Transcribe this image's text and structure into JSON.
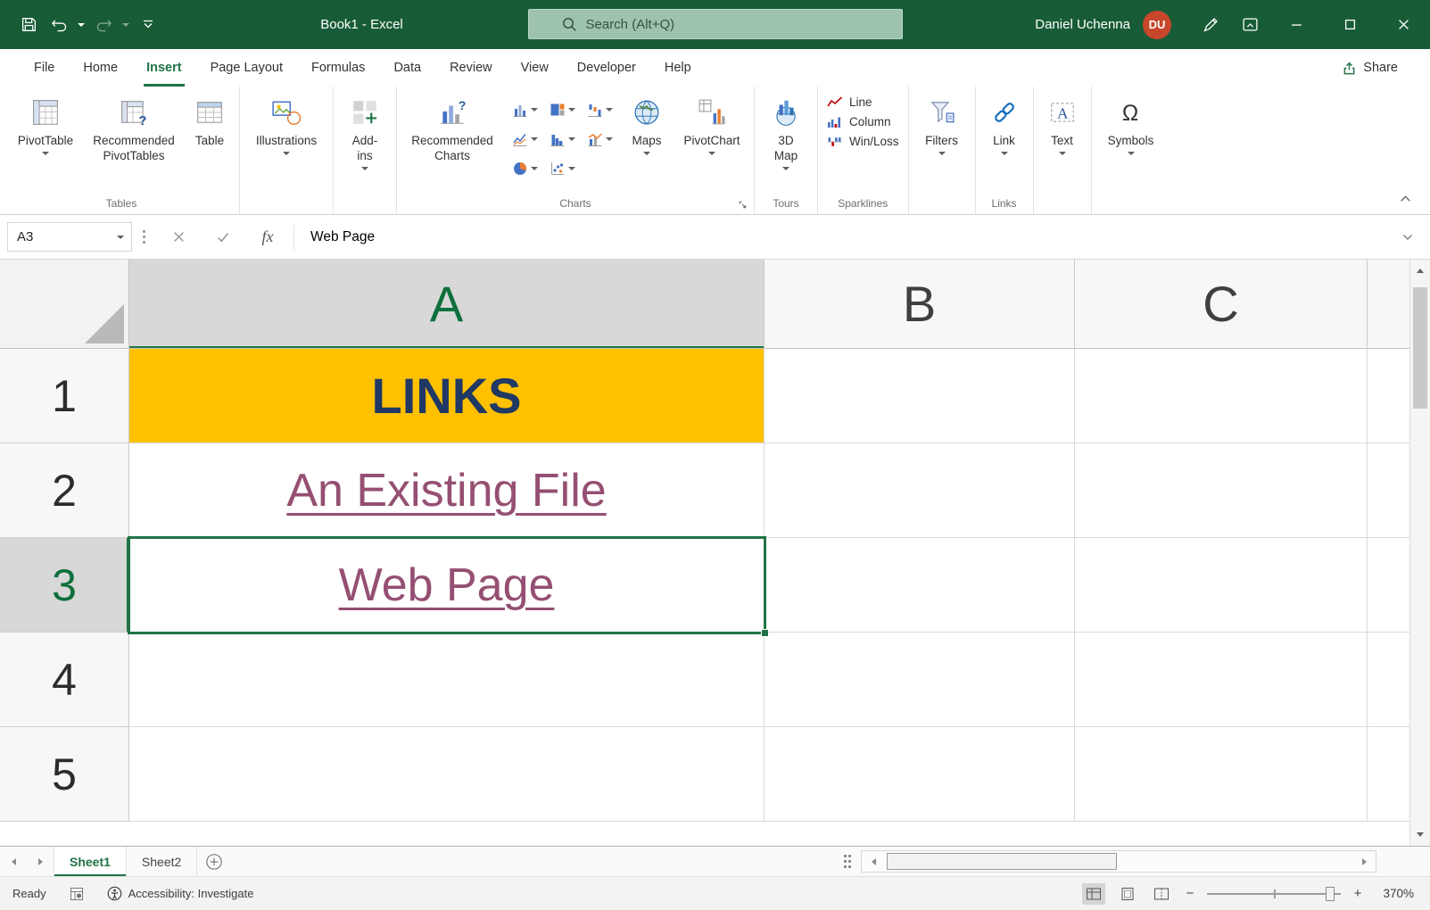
{
  "colors": {
    "title_bar_green": "#185C37",
    "accent_green": "#217346",
    "cell_fill_gold": "#FFC000",
    "links_header_navy": "#1F3864",
    "followed_hyperlink_purple": "#954F72",
    "avatar_orange": "#C8472B"
  },
  "titlebar": {
    "title": "Book1 - Excel",
    "search_placeholder": "Search (Alt+Q)",
    "user_name": "Daniel Uchenna",
    "user_initials": "DU"
  },
  "tabs": {
    "file": "File",
    "home": "Home",
    "insert": "Insert",
    "page_layout": "Page Layout",
    "formulas": "Formulas",
    "data": "Data",
    "review": "Review",
    "view": "View",
    "developer": "Developer",
    "help": "Help",
    "share": "Share"
  },
  "ribbon": {
    "pivottable": "PivotTable",
    "recommended_pivottables": "Recommended PivotTables",
    "table": "Table",
    "tables_group": "Tables",
    "illustrations": "Illustrations",
    "addins": "Add-ins",
    "recommended_charts": "Recommended Charts",
    "maps": "Maps",
    "pivotchart": "PivotChart",
    "charts_group": "Charts",
    "threed_map": "3D Map",
    "tours_group": "Tours",
    "sparkline_line": "Line",
    "sparkline_column": "Column",
    "sparkline_winloss": "Win/Loss",
    "sparklines_group": "Sparklines",
    "filters": "Filters",
    "link": "Link",
    "links_group": "Links",
    "text": "Text",
    "symbols": "Symbols"
  },
  "formula_bar": {
    "name_box": "A3",
    "fx": "fx",
    "content": "Web Page"
  },
  "grid": {
    "columns": {
      "a": "A",
      "b": "B",
      "c": "C"
    },
    "rows": {
      "r1": "1",
      "r2": "2",
      "r3": "3",
      "r4": "4",
      "r5": "5"
    },
    "cells": {
      "a1": "LINKS",
      "a2": "An Existing File",
      "a3": "Web Page"
    },
    "selected_cell": "A3"
  },
  "sheetbar": {
    "sheet1": "Sheet1",
    "sheet2": "Sheet2"
  },
  "statusbar": {
    "ready": "Ready",
    "accessibility": "Accessibility: Investigate",
    "zoom_level": "370%"
  }
}
